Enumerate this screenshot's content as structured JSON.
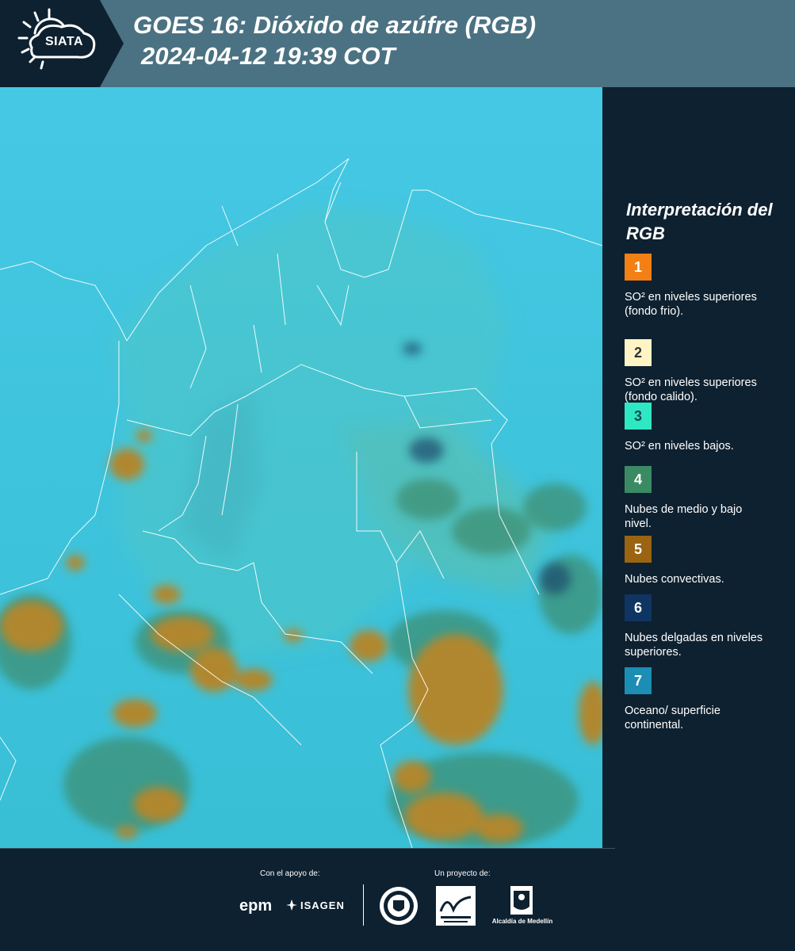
{
  "header": {
    "logo_text": "SIATA",
    "title_line1": "GOES 16: Dióxido de azúfre (RGB)",
    "title_line2": "2024-04-12 19:39 COT",
    "background_color": "#4b7282",
    "logo_background_color": "#0e2130"
  },
  "map": {
    "description_icon": "satellite-rgb-map",
    "ocean_color": "#3cc3dc",
    "cloud_convective_color": "#b0872f",
    "cloud_low_color": "#3f8c6e"
  },
  "legend": {
    "title": "Interpretación del RGB",
    "items": [
      {
        "number": "1",
        "color": "#f28014",
        "text_color": "#ffffff",
        "text": "SO² en niveles superiores (fondo frio)."
      },
      {
        "number": "2",
        "color": "#fff5c4",
        "text_color": "#333333",
        "text": "SO² en niveles superiores (fondo calido)."
      },
      {
        "number": "3",
        "color": "#2ee8c4",
        "text_color": "#1a4a50",
        "text": "SO² en niveles bajos."
      },
      {
        "number": "4",
        "color": "#3a8a64",
        "text_color": "#ffffff",
        "text": "Nubes de medio y bajo nivel."
      },
      {
        "number": "5",
        "color": "#9b6411",
        "text_color": "#ffffff",
        "text": "Nubes convectivas."
      },
      {
        "number": "6",
        "color": "#0f3563",
        "text_color": "#ffffff",
        "text": "Nubes delgadas en niveles superiores."
      },
      {
        "number": "7",
        "color": "#1c8db5",
        "text_color": "#ffffff",
        "text": "Oceano/ superficie continental."
      }
    ]
  },
  "footer": {
    "support_label": "Con el apoyo de:",
    "project_label": "Un proyecto de:",
    "epm_logo": "epm",
    "isagen_logo": "ISAGEN",
    "alcaldia_label": "Alcaldía de Medellín"
  }
}
